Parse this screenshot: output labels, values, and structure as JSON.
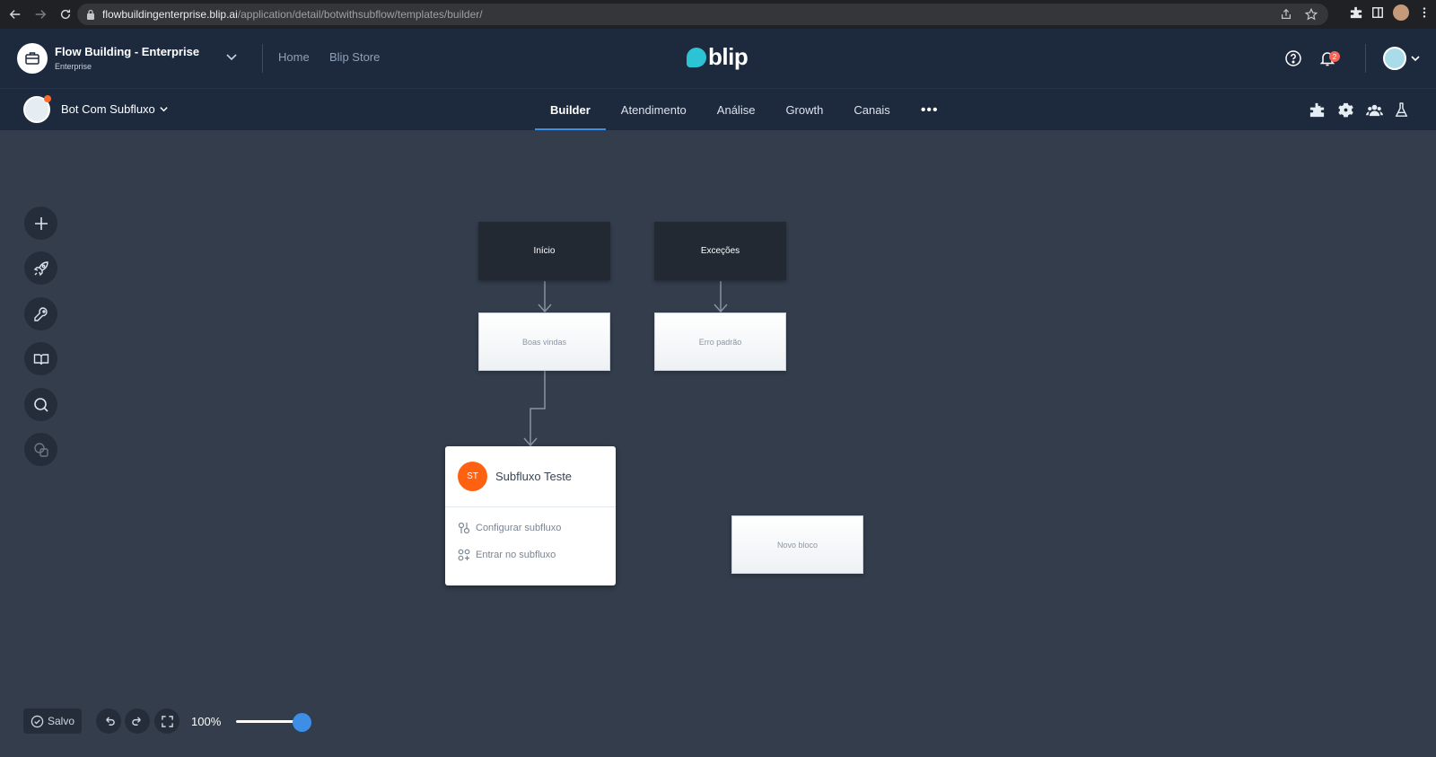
{
  "browser": {
    "url_host": "flowbuildingenterprise.blip.ai",
    "url_path": "/application/detail/botwithsubflow/templates/builder/"
  },
  "header": {
    "org_name": "Flow Building - Enterprise",
    "org_sub": "Enterprise",
    "links": [
      "Home",
      "Blip Store"
    ],
    "brand": "blip",
    "notification_count": "2"
  },
  "subheader": {
    "bot_name": "Bot Com Subfluxo",
    "tabs": [
      "Builder",
      "Atendimento",
      "Análise",
      "Growth",
      "Canais"
    ],
    "more": "•••"
  },
  "canvas": {
    "blocks": {
      "inicio": "Início",
      "excecoes": "Exceções",
      "boas_vindas": "Boas vindas",
      "erro_padrao": "Erro padrão",
      "novo_bloco": "Novo bloco"
    },
    "subflow": {
      "badge": "ST",
      "title": "Subfluxo Teste",
      "configure": "Configurar subfluxo",
      "enter": "Entrar no subfluxo"
    }
  },
  "footer": {
    "saved": "Salvo",
    "zoom": "100%",
    "zoom_level_percent": 100
  },
  "colors": {
    "accent": "#3f8ee5",
    "brand": "#2cc3d5",
    "subflow_badge": "#ff6112",
    "header_bg": "#1d2a3e",
    "canvas_bg": "#333d4b"
  }
}
